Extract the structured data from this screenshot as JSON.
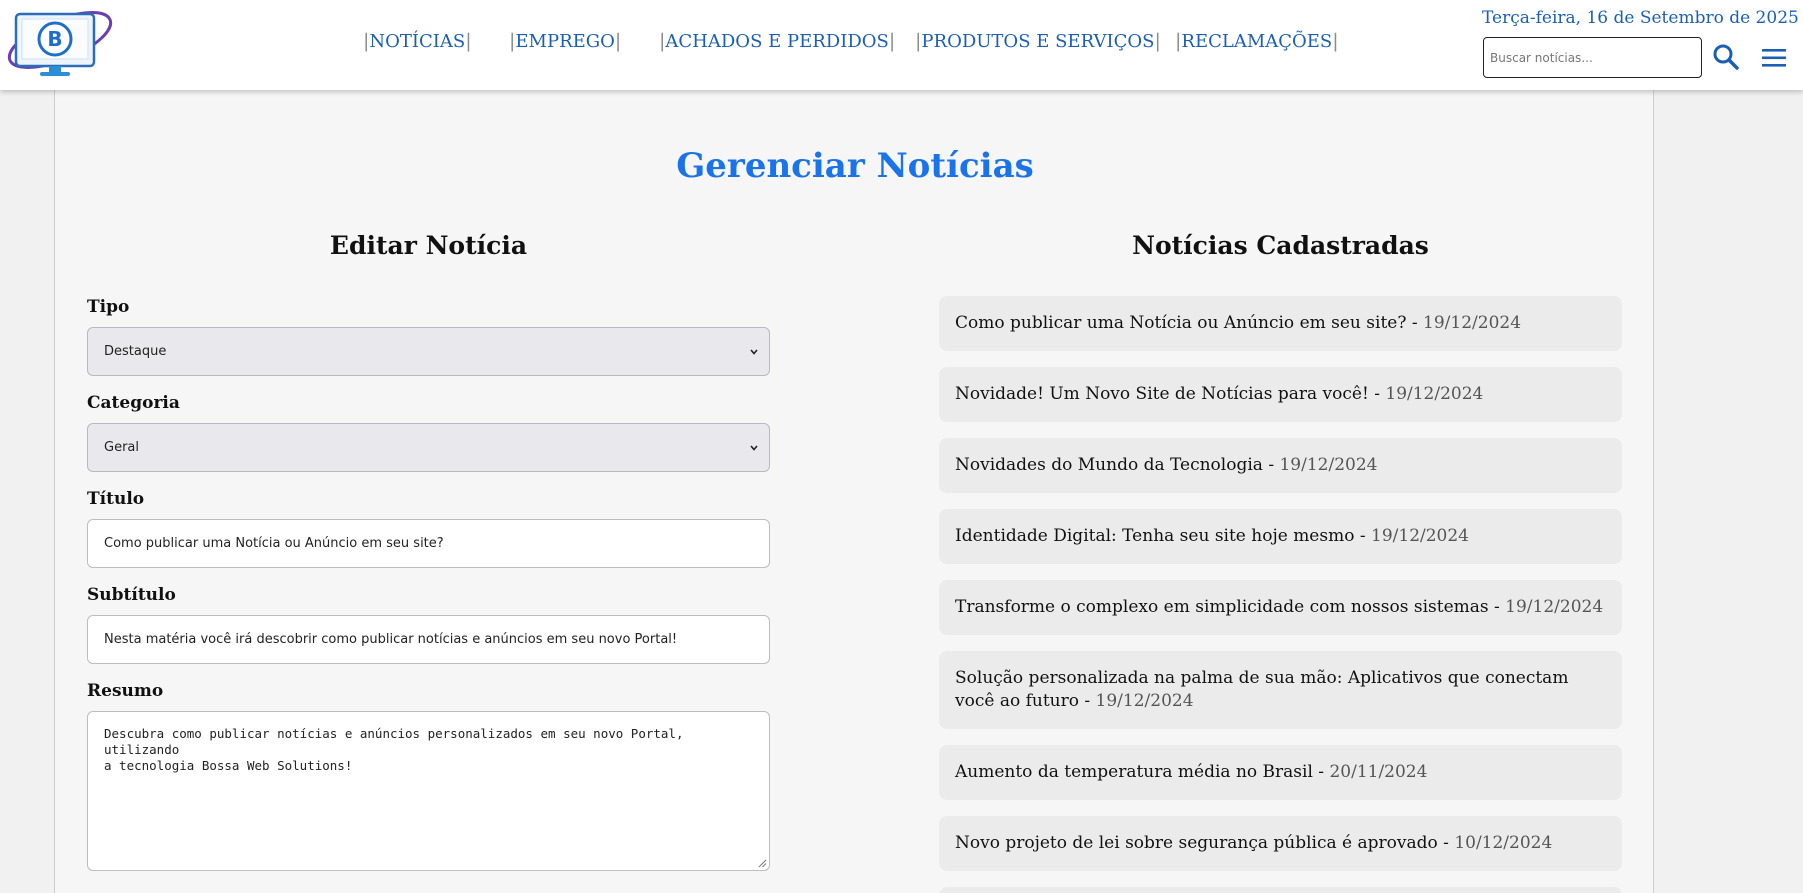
{
  "header": {
    "logo_letter": "B",
    "nav": [
      {
        "label": "NOTÍCIAS"
      },
      {
        "label": "EMPREGO"
      },
      {
        "label": "ACHADOS E PERDIDOS"
      },
      {
        "label": "PRODUTOS E SERVIÇOS"
      },
      {
        "label": "RECLAMAÇÕES"
      }
    ],
    "date": "Terça-feira, 16 de Setembro de 2025",
    "search_placeholder": "Buscar notícias...",
    "search_icon": "search-icon",
    "menu_icon": "hamburger-menu-icon"
  },
  "page": {
    "title": "Gerenciar Notícias"
  },
  "form": {
    "title": "Editar Notícia",
    "tipo_label": "Tipo",
    "tipo_value": "Destaque",
    "categoria_label": "Categoria",
    "categoria_value": "Geral",
    "titulo_label": "Título",
    "titulo_value": "Como publicar uma Notícia ou Anúncio em seu site?",
    "subtitulo_label": "Subtítulo",
    "subtitulo_value": "Nesta matéria você irá descobrir como publicar notícias e anúncios em seu novo Portal!",
    "resumo_label": "Resumo",
    "resumo_value": "Descubra como publicar notícias e anúncios personalizados em seu novo Portal, utilizando\na tecnologia Bossa Web Solutions!"
  },
  "list": {
    "title": "Notícias Cadastradas",
    "separator": " - ",
    "items": [
      {
        "title": "Como publicar uma Notícia ou Anúncio em seu site?",
        "date": "19/12/2024"
      },
      {
        "title": "Novidade! Um Novo Site de Notícias para você!",
        "date": "19/12/2024"
      },
      {
        "title": "Novidades do Mundo da Tecnologia",
        "date": "19/12/2024"
      },
      {
        "title": "Identidade Digital: Tenha seu site hoje mesmo",
        "date": "19/12/2024"
      },
      {
        "title": "Transforme o complexo em simplicidade com nossos sistemas",
        "date": "19/12/2024"
      },
      {
        "title": "Solução personalizada na palma de sua mão: Aplicativos que conectam você ao futuro",
        "date": "19/12/2024"
      },
      {
        "title": "Aumento da temperatura média no Brasil",
        "date": "20/11/2024"
      },
      {
        "title": "Novo projeto de lei sobre segurança pública é aprovado",
        "date": "10/12/2024"
      }
    ]
  },
  "colors": {
    "accent": "#1a73e8",
    "nav_link": "#1a5fb4",
    "item_bg": "#ebebeb"
  }
}
